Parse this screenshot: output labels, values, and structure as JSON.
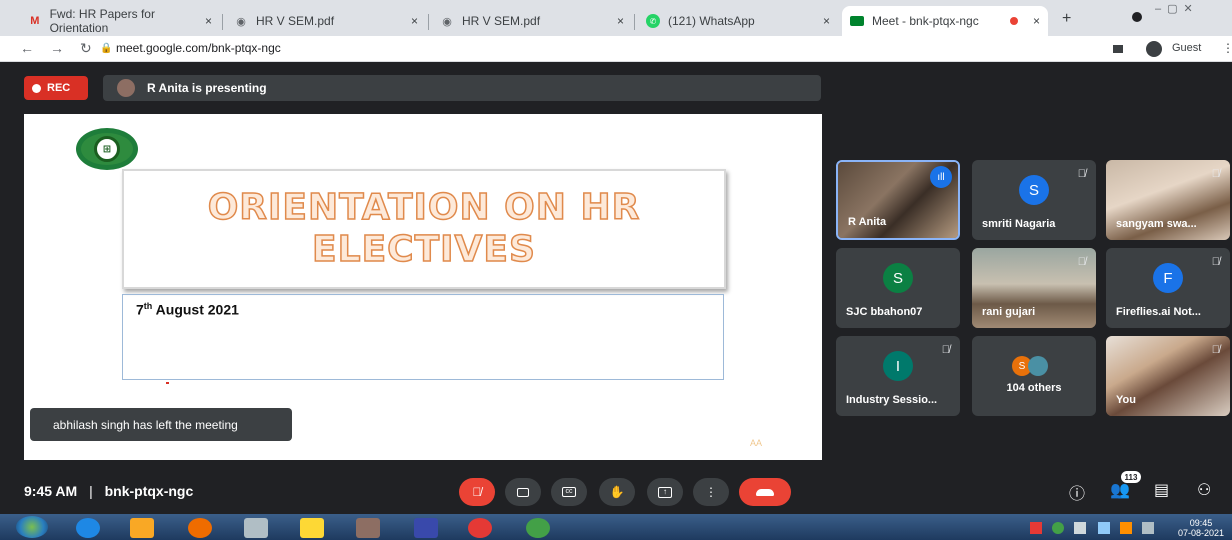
{
  "browser": {
    "tabs": [
      {
        "label": "Fwd: HR Papers for Orientation",
        "icon": "gmail-icon",
        "close": "×"
      },
      {
        "label": "HR V SEM.pdf",
        "icon": "globe-icon",
        "close": "×"
      },
      {
        "label": "HR V SEM.pdf",
        "icon": "globe-icon",
        "close": "×"
      },
      {
        "label": "(121) WhatsApp",
        "icon": "whatsapp-icon",
        "close": "×"
      },
      {
        "label": "Meet - bnk-ptqx-ngc",
        "icon": "meet-icon",
        "close": "×"
      }
    ],
    "new_tab": "+",
    "url": "meet.google.com/bnk-ptqx-ngc",
    "profile": "Guest"
  },
  "meet": {
    "rec_label": "REC",
    "presenting_text": "R Anita is presenting",
    "slide": {
      "title_line1": "ORIENTATION ON HR",
      "title_line2": "ELECTIVES",
      "date_day": "7",
      "date_suffix": "th",
      "date_rest": " August 2021",
      "mark": "AA"
    },
    "toast": "abhilash singh has left the meeting",
    "participants": [
      {
        "name": "R Anita",
        "type": "video"
      },
      {
        "name": "smriti Nagaria",
        "initial": "S",
        "color": "#1a73e8"
      },
      {
        "name": "sangyam swa...",
        "type": "video"
      },
      {
        "name": "SJC bbahon07",
        "initial": "S",
        "color": "#0b8043"
      },
      {
        "name": "rani gujari",
        "type": "video"
      },
      {
        "name": "Fireflies.ai Not...",
        "initial": "F",
        "color": "#1a73e8"
      },
      {
        "name": "Industry Sessio...",
        "initial": "I",
        "color": "#00796b"
      },
      {
        "name": "104 others",
        "initial": "S",
        "color": "#e8710a"
      },
      {
        "name": "You",
        "type": "video"
      }
    ],
    "time": "9:45 AM",
    "separator": "|",
    "meeting_code": "bnk-ptqx-ngc",
    "people_count": "113",
    "accent_red": "#ea4335"
  },
  "taskbar": {
    "clock_time": "09:45",
    "clock_date": "07-08-2021"
  }
}
